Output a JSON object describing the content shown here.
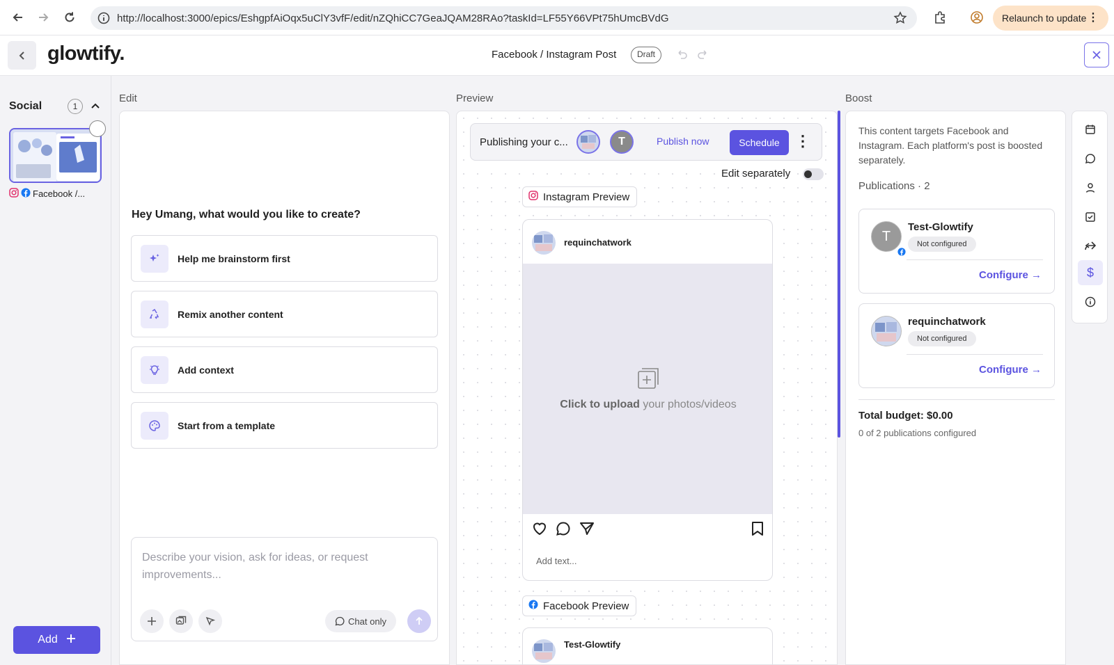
{
  "browser": {
    "url": "http://localhost:3000/epics/EshgpfAiOqx5uClY3vfF/edit/nZQhiCC7GeaJQAM28RAo?taskId=LF55Y66VPt75hUmcBVdG",
    "relaunch_label": "Relaunch to update"
  },
  "header": {
    "logo": "glowtify.",
    "title": "Facebook / Instagram Post",
    "status": "Draft"
  },
  "sidebar": {
    "section": "Social",
    "count": "1",
    "item_label": "Facebook /...",
    "add_label": "Add"
  },
  "sections": {
    "edit": "Edit",
    "preview": "Preview",
    "boost": "Boost"
  },
  "edit": {
    "greeting": "Hey Umang, what would you like to create?",
    "options": [
      {
        "label": "Help me brainstorm first",
        "icon": "sparkles-icon"
      },
      {
        "label": "Remix another content",
        "icon": "recycle-icon"
      },
      {
        "label": "Add context",
        "icon": "lightbulb-icon"
      },
      {
        "label": "Start from a template",
        "icon": "palette-icon"
      }
    ],
    "chat_placeholder": "Describe your vision, ask for ideas, or request improvements...",
    "chat_only_label": "Chat only"
  },
  "preview": {
    "publishing_text": "Publishing your c...",
    "publish_now": "Publish now",
    "schedule": "Schedule",
    "edit_separately": "Edit separately",
    "edit_separately_on": false,
    "instagram_chip": "Instagram Preview",
    "instagram_user": "requinchatwork",
    "upload_bold": "Click to upload",
    "upload_rest": " your photos/videos",
    "add_text": "Add text...",
    "facebook_chip": "Facebook Preview",
    "facebook_user": "Test-Glowtify"
  },
  "boost": {
    "description": "This content targets Facebook and Instagram. Each platform's post is boosted separately.",
    "publications": "Publications · 2",
    "accounts": [
      {
        "name": "Test-Glowtify",
        "status": "Not configured",
        "action": "Configure →",
        "avatar_letter": "T",
        "platform": "facebook"
      },
      {
        "name": "requinchatwork",
        "status": "Not configured",
        "action": "Configure →",
        "platform": "instagram"
      }
    ],
    "total_budget": "Total budget: $0.00",
    "configured_count": "0 of 2 publications configured"
  },
  "rail": [
    "calendar-icon",
    "comment-icon",
    "user-icon",
    "checkbox-icon",
    "share-icon",
    "dollar-icon",
    "info-icon"
  ],
  "colors": {
    "accent": "#5b53e0",
    "accent_light": "#ecebfb",
    "relaunch": "#fde3c8",
    "instagram": "#e1306c",
    "facebook": "#1877f2"
  }
}
